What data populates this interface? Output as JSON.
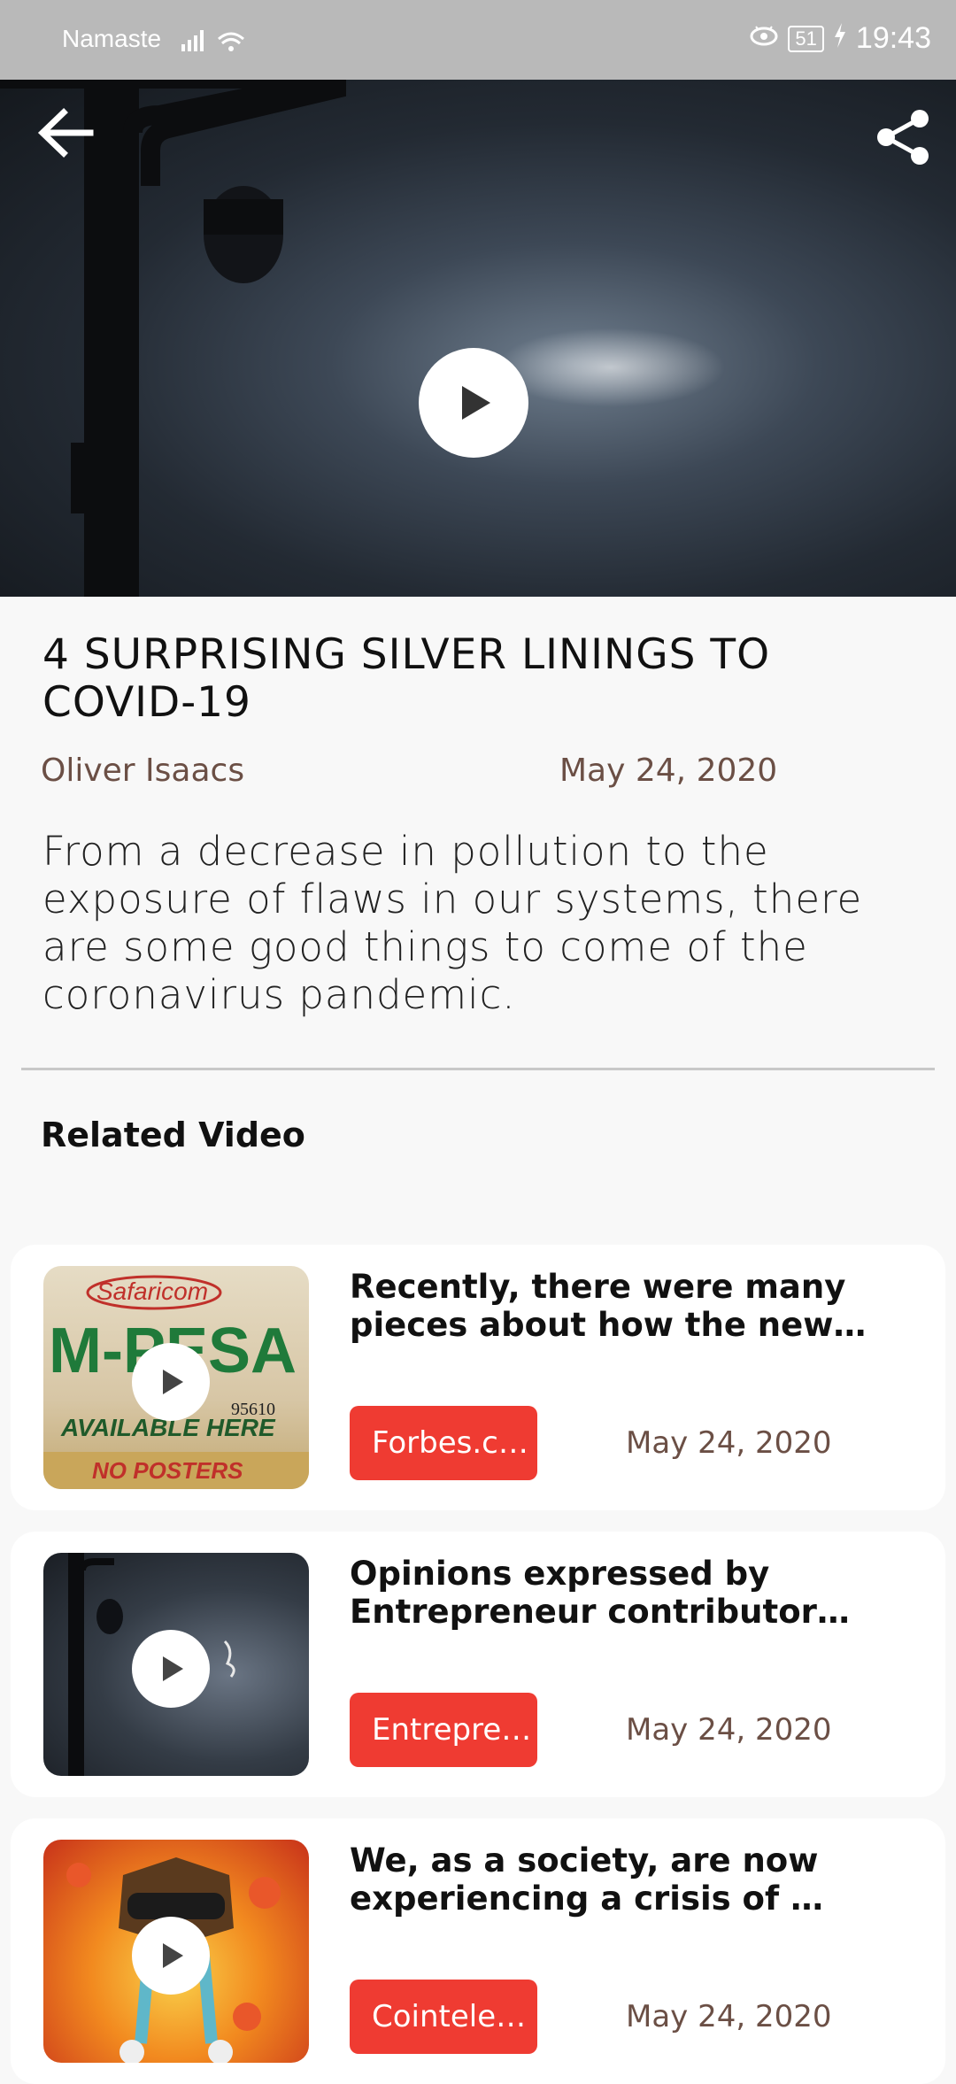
{
  "status_bar": {
    "carrier": "Namaste",
    "battery": "51",
    "time": "19:43"
  },
  "article": {
    "title": "4 SURPRISING SILVER LININGS TO COVID-19",
    "author": "Oliver Isaacs",
    "date": "May 24, 2020",
    "summary": "From a decrease in pollution to the exposure of flaws in our systems, there are some good things to come of the coronavirus pandemic."
  },
  "related": {
    "heading": "Related Video",
    "items": [
      {
        "text": "Recently, there were many pieces about how the new…",
        "source": "Forbes.c…",
        "date": "May 24, 2020",
        "thumb_words": [
          "Safaricom",
          "M-PESA",
          "95610",
          "AVAILABLE HERE",
          "NO POSTERS"
        ]
      },
      {
        "text": "Opinions expressed by Entrepreneur contributor…",
        "source": "Entrepre…",
        "date": "May 24, 2020"
      },
      {
        "text": "We, as a society, are now experiencing a crisis of …",
        "source": "Cointele…",
        "date": "May 24, 2020"
      }
    ]
  },
  "colors": {
    "accent_red": "#ef3b32",
    "date_brown": "#6b4f45",
    "status_gray": "#b9b9b9"
  },
  "icons": [
    "back-arrow-icon",
    "share-icon",
    "play-icon",
    "signal-icon",
    "wifi-icon",
    "eye-icon",
    "battery-icon",
    "charging-icon"
  ]
}
